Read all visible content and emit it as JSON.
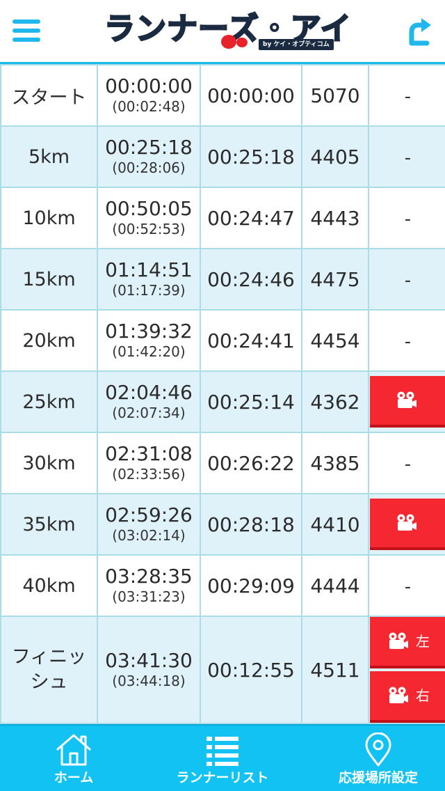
{
  "header": {
    "logo_text": "ランナーズ・アイ",
    "logo_sub": "by ケイ・オプティコム",
    "menu_icon": "hamburger-icon",
    "refresh_icon": "refresh-icon"
  },
  "splits": [
    {
      "point": "スタート",
      "time": "00:00:00",
      "gross": "(00:02:48)",
      "lap": "00:00:00",
      "rank": "5070",
      "video": "-"
    },
    {
      "point": "5km",
      "time": "00:25:18",
      "gross": "(00:28:06)",
      "lap": "00:25:18",
      "rank": "4405",
      "video": "-"
    },
    {
      "point": "10km",
      "time": "00:50:05",
      "gross": "(00:52:53)",
      "lap": "00:24:47",
      "rank": "4443",
      "video": "-"
    },
    {
      "point": "15km",
      "time": "01:14:51",
      "gross": "(01:17:39)",
      "lap": "00:24:46",
      "rank": "4475",
      "video": "-"
    },
    {
      "point": "20km",
      "time": "01:39:32",
      "gross": "(01:42:20)",
      "lap": "00:24:41",
      "rank": "4454",
      "video": "-"
    },
    {
      "point": "25km",
      "time": "02:04:46",
      "gross": "(02:07:34)",
      "lap": "00:25:14",
      "rank": "4362",
      "video": "camera-icon"
    },
    {
      "point": "30km",
      "time": "02:31:08",
      "gross": "(02:33:56)",
      "lap": "00:26:22",
      "rank": "4385",
      "video": "-"
    },
    {
      "point": "35km",
      "time": "02:59:26",
      "gross": "(03:02:14)",
      "lap": "00:28:18",
      "rank": "4410",
      "video": "camera-icon"
    },
    {
      "point": "40km",
      "time": "03:28:35",
      "gross": "(03:31:23)",
      "lap": "00:29:09",
      "rank": "4444",
      "video": "-"
    }
  ],
  "finish": {
    "point_line1": "フィニッ",
    "point_line2": "シュ",
    "time": "03:41:30",
    "gross": "(03:44:18)",
    "lap": "00:12:55",
    "rank": "4511",
    "video_left": "左",
    "video_right": "右"
  },
  "footer": {
    "home": "ホーム",
    "runner_list": "ランナーリスト",
    "support_location": "応援場所設定"
  },
  "colors": {
    "accent": "#12c2f2",
    "row_alt": "#dff2f9",
    "border": "#a9dde8",
    "camera_button": "#f52730"
  }
}
